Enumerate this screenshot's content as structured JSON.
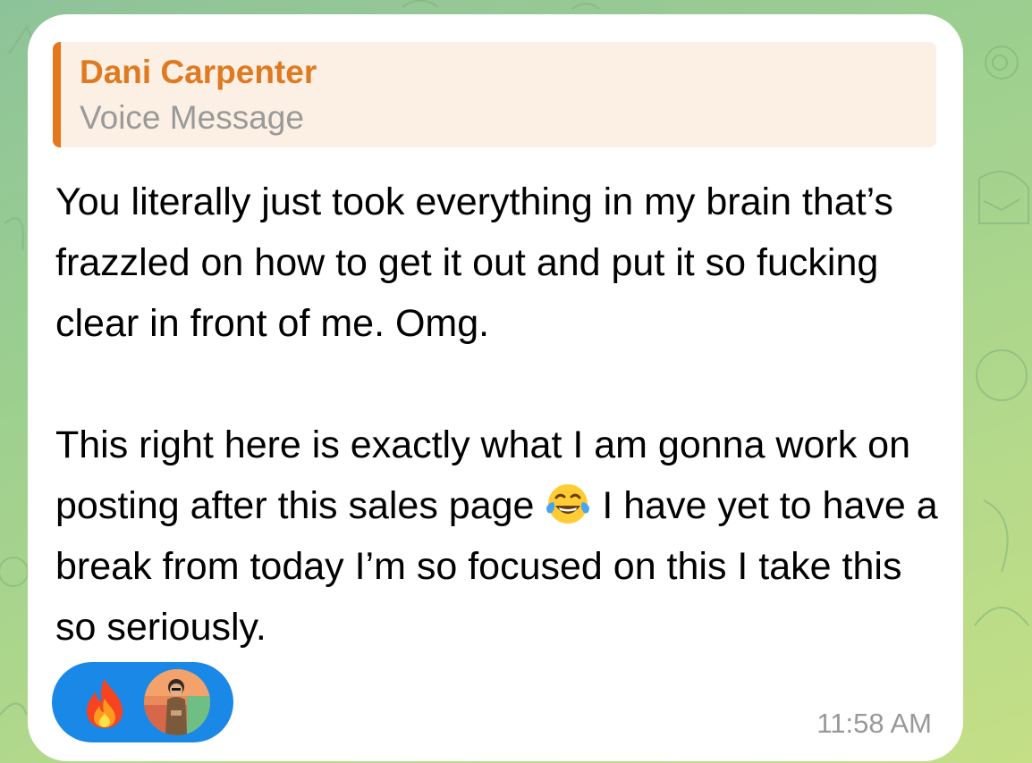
{
  "colors": {
    "reply_accent": "#e5781c",
    "reply_name": "#de7a21",
    "reply_background": "#fcefe4",
    "reaction_pill": "#1a88e6",
    "timestamp": "#999999",
    "wallpaper": "#9ccf8f"
  },
  "reply": {
    "sender": "Dani Carpenter",
    "preview": "Voice Message"
  },
  "message": {
    "paragraph1": "You literally just took everything in my brain that’s frazzled on how to get it out and put it so fucking clear in front of me. Omg.",
    "paragraph2_before_emoji": "This right here is exactly what I am gonna work on posting after this sales page ",
    "paragraph2_emoji": "face-with-tears-of-joy",
    "paragraph2_after_emoji": " I have yet to have a break from today I’m so focused on this I take this so seriously."
  },
  "reactions": {
    "emoji": "fire-icon",
    "reactor_avatar": "user-avatar"
  },
  "timestamp": "11:58 AM"
}
